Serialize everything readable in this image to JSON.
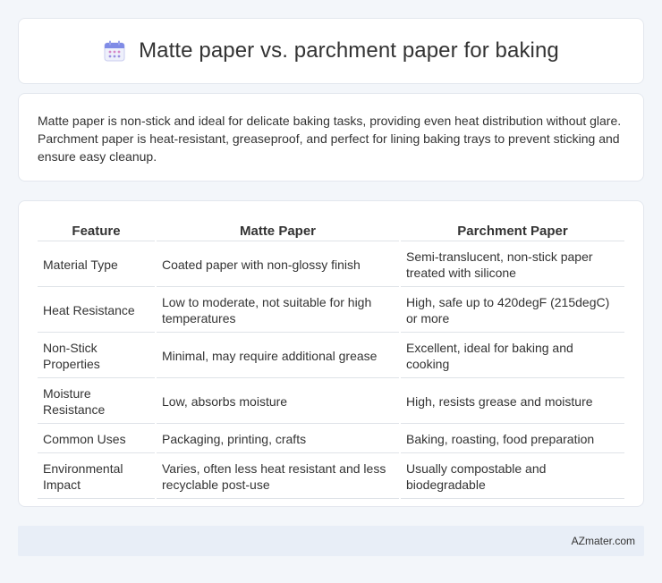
{
  "header": {
    "title": "Matte paper vs. parchment paper for baking",
    "icon": "calendar-icon"
  },
  "intro": {
    "text": "Matte paper is non-stick and ideal for delicate baking tasks, providing even heat distribution without glare. Parchment paper is heat-resistant, greaseproof, and perfect for lining baking trays to prevent sticking and ensure easy cleanup."
  },
  "table": {
    "headers": [
      "Feature",
      "Matte Paper",
      "Parchment Paper"
    ],
    "rows": [
      [
        "Material Type",
        "Coated paper with non-glossy finish",
        "Semi-translucent, non-stick paper treated with silicone"
      ],
      [
        "Heat Resistance",
        "Low to moderate, not suitable for high temperatures",
        "High, safe up to 420degF (215degC) or more"
      ],
      [
        "Non-Stick Properties",
        "Minimal, may require additional grease",
        "Excellent, ideal for baking and cooking"
      ],
      [
        "Moisture Resistance",
        "Low, absorbs moisture",
        "High, resists grease and moisture"
      ],
      [
        "Common Uses",
        "Packaging, printing, crafts",
        "Baking, roasting, food preparation"
      ],
      [
        "Environmental Impact",
        "Varies, often less heat resistant and less recyclable post-use",
        "Usually compostable and biodegradable"
      ]
    ]
  },
  "footer": {
    "text": "AZmater.com"
  },
  "colors": {
    "background": "#f3f6fa",
    "card": "#ffffff",
    "footer": "#e8eef7",
    "icon_accent": "#8b7fe0"
  }
}
